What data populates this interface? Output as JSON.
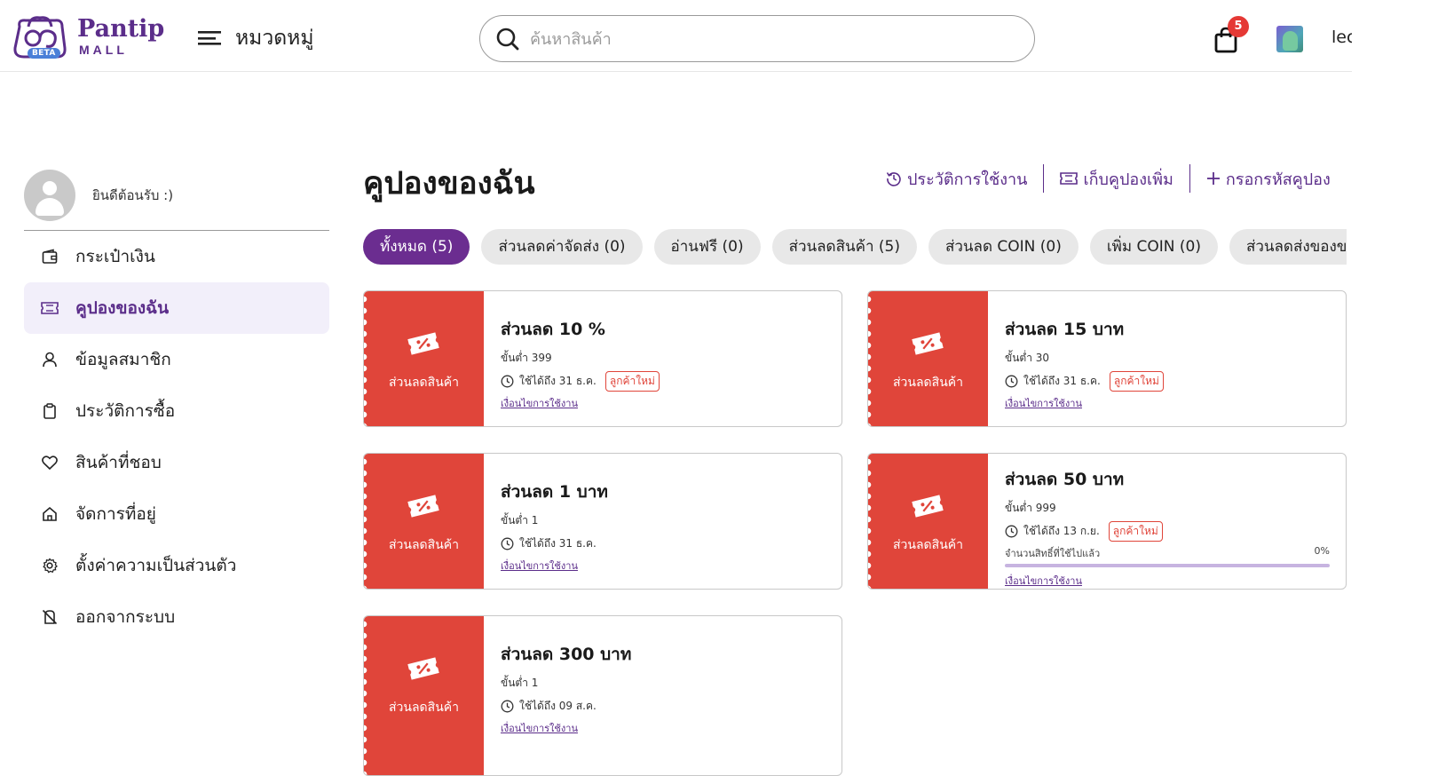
{
  "header": {
    "logo_text": "Pantip",
    "logo_subtext": "MALL",
    "beta_label": "BETA",
    "menu_label": "หมวดหมู่",
    "search_placeholder": "ค้นหาสินค้า",
    "cart_count": "5",
    "username": "lec"
  },
  "sidebar": {
    "welcome": "ยินดีต้อนรับ :)",
    "items": [
      {
        "label": "กระเป๋าเงิน",
        "icon": "wallet-icon"
      },
      {
        "label": "คูปองของฉัน",
        "icon": "ticket-icon",
        "active": true
      },
      {
        "label": "ข้อมูลสมาชิก",
        "icon": "user-icon"
      },
      {
        "label": "ประวัติการซื้อ",
        "icon": "clipboard-icon"
      },
      {
        "label": "สินค้าที่ชอบ",
        "icon": "heart-icon"
      },
      {
        "label": "จัดการที่อยู่",
        "icon": "home-icon"
      },
      {
        "label": "ตั้งค่าความเป็นส่วนตัว",
        "icon": "gear-icon"
      },
      {
        "label": "ออกจากระบบ",
        "icon": "logout-icon"
      }
    ]
  },
  "main": {
    "title": "คูปองของฉัน",
    "actions": {
      "history": "ประวัติการใช้งาน",
      "collect": "เก็บคูปองเพิ่ม",
      "enter_code": "กรอกรหัสคูปอง"
    },
    "filters": [
      "ทั้งหมด (5)",
      "ส่วนลดค่าจัดส่ง (0)",
      "อ่านฟรี (0)",
      "ส่วนลดสินค้า (5)",
      "ส่วนลด COIN (0)",
      "เพิ่ม COIN (0)",
      "ส่วนลดส่งของขวัญ"
    ],
    "stub_label": "ส่วนลดสินค้า",
    "condition_link": "เงื่อนไขการใช้งาน",
    "coupons": [
      {
        "title": "ส่วนลด 10 %",
        "min": "ขั้นต่ำ 399",
        "expiry": "ใช้ได้ถึง 31 ธ.ค.",
        "new_tag": "ลูกค้าใหม่"
      },
      {
        "title": "ส่วนลด 15 บาท",
        "min": "ขั้นต่ำ 30",
        "expiry": "ใช้ได้ถึง 31 ธ.ค.",
        "new_tag": "ลูกค้าใหม่"
      },
      {
        "title": "ส่วนลด 1 บาท",
        "min": "ขั้นต่ำ 1",
        "expiry": "ใช้ได้ถึง 31 ธ.ค."
      },
      {
        "title": "ส่วนลด 50 บาท",
        "min": "ขั้นต่ำ 999",
        "expiry": "ใช้ได้ถึง 13 ก.ย.",
        "new_tag": "ลูกค้าใหม่",
        "usage_label": "จำนวนสิทธิ์ที่ใช้ไปแล้ว",
        "usage_percent": "0%",
        "usage_fraction": 0
      },
      {
        "title": "ส่วนลด 300 บาท",
        "min": "ขั้นต่ำ 1",
        "expiry": "ใช้ได้ถึง 09 ส.ค."
      }
    ]
  },
  "colors": {
    "brand_purple": "#5b2d8a",
    "chip_active": "#6b2d90",
    "coupon_red": "#e0453a",
    "badge_red": "#e53935"
  }
}
